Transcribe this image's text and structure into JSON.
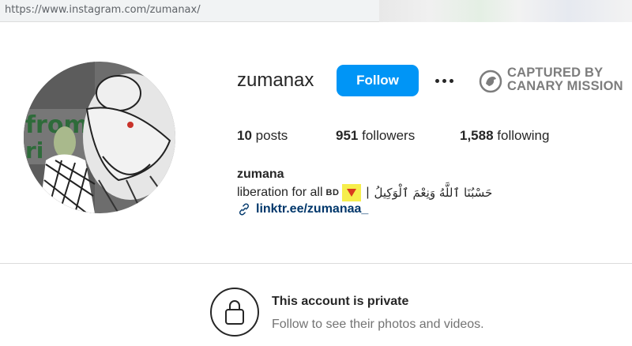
{
  "browser": {
    "url": "https://www.instagram.com/zumanax/"
  },
  "profile": {
    "username": "zumanax",
    "follow_label": "Follow",
    "more_label": "•••",
    "stats": {
      "posts_count": "10",
      "posts_label": "posts",
      "followers_count": "951",
      "followers_label": "followers",
      "following_count": "1,588",
      "following_label": "following"
    },
    "full_name": "zumana",
    "bio_text": "liberation for all",
    "bio_flag_text": "BD",
    "bio_separator": "|",
    "bio_arabic": "حَسْبُنَا ٱللَّهُ وَنِعْمَ ٱلْوَكِيلُ",
    "link_text": "linktr.ee/zumanaa_"
  },
  "watermark": {
    "line1": "CAPTURED BY",
    "line2": "CANARY MISSION"
  },
  "private_notice": {
    "title": "This account is private",
    "subtitle": "Follow to see their photos and videos."
  },
  "colors": {
    "follow_button": "#0095f6",
    "link": "#00376b",
    "watermark": "#7d7d7d",
    "highlight": "#f6ee4c"
  }
}
